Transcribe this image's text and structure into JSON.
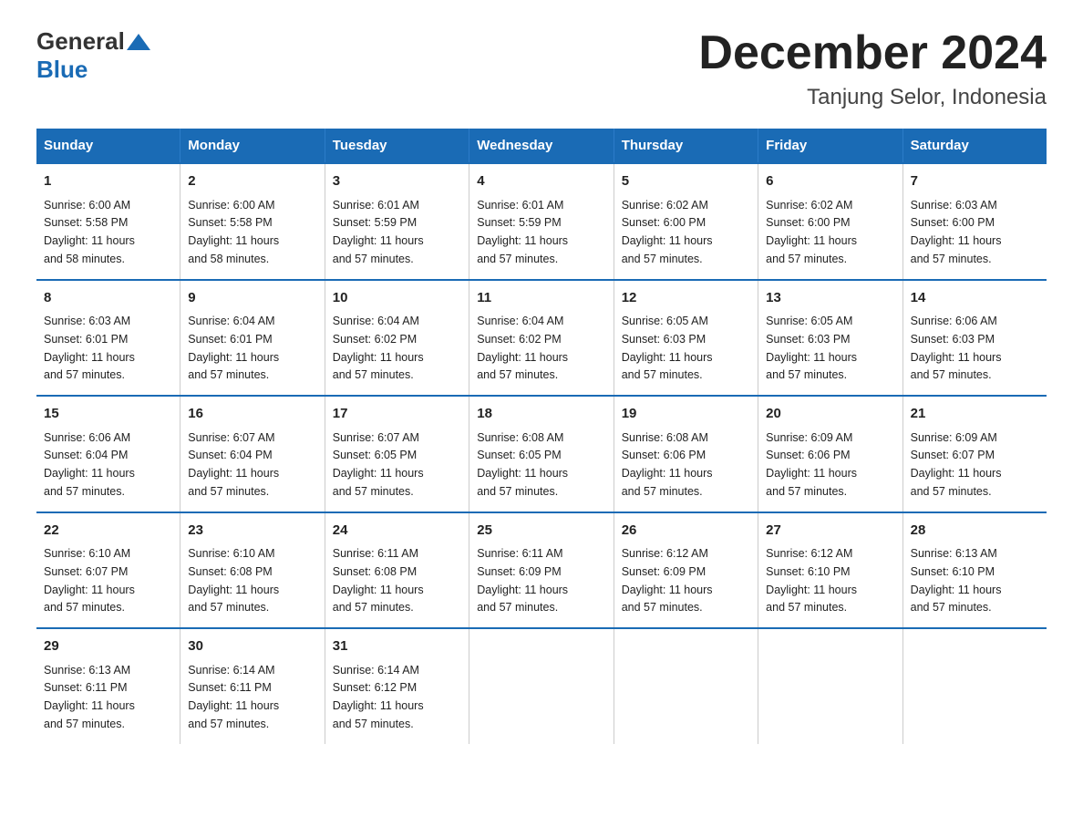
{
  "header": {
    "logo_general": "General",
    "logo_blue": "Blue",
    "title": "December 2024",
    "subtitle": "Tanjung Selor, Indonesia"
  },
  "days_of_week": [
    "Sunday",
    "Monday",
    "Tuesday",
    "Wednesday",
    "Thursday",
    "Friday",
    "Saturday"
  ],
  "weeks": [
    [
      {
        "day": "1",
        "sunrise": "6:00 AM",
        "sunset": "5:58 PM",
        "daylight": "11 hours and 58 minutes."
      },
      {
        "day": "2",
        "sunrise": "6:00 AM",
        "sunset": "5:58 PM",
        "daylight": "11 hours and 58 minutes."
      },
      {
        "day": "3",
        "sunrise": "6:01 AM",
        "sunset": "5:59 PM",
        "daylight": "11 hours and 57 minutes."
      },
      {
        "day": "4",
        "sunrise": "6:01 AM",
        "sunset": "5:59 PM",
        "daylight": "11 hours and 57 minutes."
      },
      {
        "day": "5",
        "sunrise": "6:02 AM",
        "sunset": "6:00 PM",
        "daylight": "11 hours and 57 minutes."
      },
      {
        "day": "6",
        "sunrise": "6:02 AM",
        "sunset": "6:00 PM",
        "daylight": "11 hours and 57 minutes."
      },
      {
        "day": "7",
        "sunrise": "6:03 AM",
        "sunset": "6:00 PM",
        "daylight": "11 hours and 57 minutes."
      }
    ],
    [
      {
        "day": "8",
        "sunrise": "6:03 AM",
        "sunset": "6:01 PM",
        "daylight": "11 hours and 57 minutes."
      },
      {
        "day": "9",
        "sunrise": "6:04 AM",
        "sunset": "6:01 PM",
        "daylight": "11 hours and 57 minutes."
      },
      {
        "day": "10",
        "sunrise": "6:04 AM",
        "sunset": "6:02 PM",
        "daylight": "11 hours and 57 minutes."
      },
      {
        "day": "11",
        "sunrise": "6:04 AM",
        "sunset": "6:02 PM",
        "daylight": "11 hours and 57 minutes."
      },
      {
        "day": "12",
        "sunrise": "6:05 AM",
        "sunset": "6:03 PM",
        "daylight": "11 hours and 57 minutes."
      },
      {
        "day": "13",
        "sunrise": "6:05 AM",
        "sunset": "6:03 PM",
        "daylight": "11 hours and 57 minutes."
      },
      {
        "day": "14",
        "sunrise": "6:06 AM",
        "sunset": "6:03 PM",
        "daylight": "11 hours and 57 minutes."
      }
    ],
    [
      {
        "day": "15",
        "sunrise": "6:06 AM",
        "sunset": "6:04 PM",
        "daylight": "11 hours and 57 minutes."
      },
      {
        "day": "16",
        "sunrise": "6:07 AM",
        "sunset": "6:04 PM",
        "daylight": "11 hours and 57 minutes."
      },
      {
        "day": "17",
        "sunrise": "6:07 AM",
        "sunset": "6:05 PM",
        "daylight": "11 hours and 57 minutes."
      },
      {
        "day": "18",
        "sunrise": "6:08 AM",
        "sunset": "6:05 PM",
        "daylight": "11 hours and 57 minutes."
      },
      {
        "day": "19",
        "sunrise": "6:08 AM",
        "sunset": "6:06 PM",
        "daylight": "11 hours and 57 minutes."
      },
      {
        "day": "20",
        "sunrise": "6:09 AM",
        "sunset": "6:06 PM",
        "daylight": "11 hours and 57 minutes."
      },
      {
        "day": "21",
        "sunrise": "6:09 AM",
        "sunset": "6:07 PM",
        "daylight": "11 hours and 57 minutes."
      }
    ],
    [
      {
        "day": "22",
        "sunrise": "6:10 AM",
        "sunset": "6:07 PM",
        "daylight": "11 hours and 57 minutes."
      },
      {
        "day": "23",
        "sunrise": "6:10 AM",
        "sunset": "6:08 PM",
        "daylight": "11 hours and 57 minutes."
      },
      {
        "day": "24",
        "sunrise": "6:11 AM",
        "sunset": "6:08 PM",
        "daylight": "11 hours and 57 minutes."
      },
      {
        "day": "25",
        "sunrise": "6:11 AM",
        "sunset": "6:09 PM",
        "daylight": "11 hours and 57 minutes."
      },
      {
        "day": "26",
        "sunrise": "6:12 AM",
        "sunset": "6:09 PM",
        "daylight": "11 hours and 57 minutes."
      },
      {
        "day": "27",
        "sunrise": "6:12 AM",
        "sunset": "6:10 PM",
        "daylight": "11 hours and 57 minutes."
      },
      {
        "day": "28",
        "sunrise": "6:13 AM",
        "sunset": "6:10 PM",
        "daylight": "11 hours and 57 minutes."
      }
    ],
    [
      {
        "day": "29",
        "sunrise": "6:13 AM",
        "sunset": "6:11 PM",
        "daylight": "11 hours and 57 minutes."
      },
      {
        "day": "30",
        "sunrise": "6:14 AM",
        "sunset": "6:11 PM",
        "daylight": "11 hours and 57 minutes."
      },
      {
        "day": "31",
        "sunrise": "6:14 AM",
        "sunset": "6:12 PM",
        "daylight": "11 hours and 57 minutes."
      },
      null,
      null,
      null,
      null
    ]
  ],
  "labels": {
    "sunrise": "Sunrise:",
    "sunset": "Sunset:",
    "daylight": "Daylight:"
  }
}
